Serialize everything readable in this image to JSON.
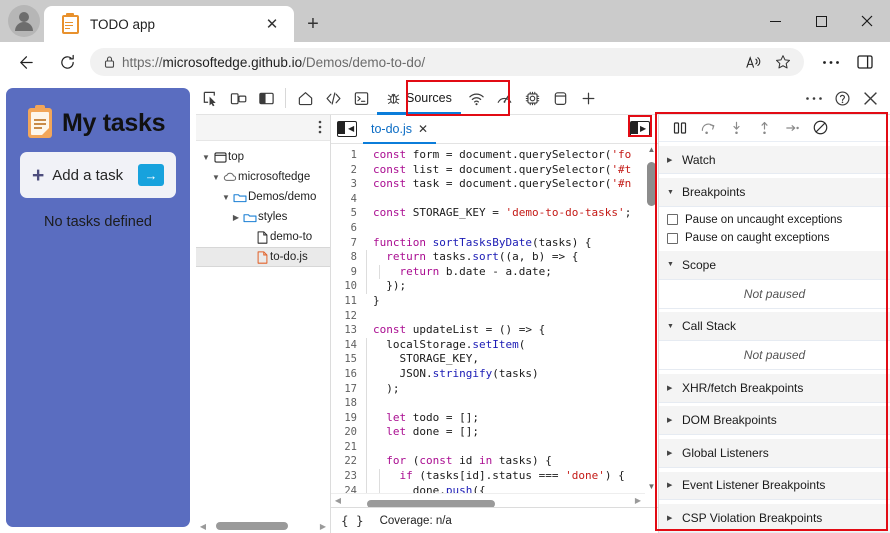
{
  "browser": {
    "tab": {
      "title": "TODO app",
      "favicon": "clipboard-icon",
      "close": "✕"
    },
    "newtab_label": "+",
    "window_controls": {
      "minimize": "—",
      "maximize": "☐",
      "close": "✕"
    },
    "address": {
      "url_prefix": "https://",
      "url_host": "microsoftedge.github.io",
      "url_path": "/Demos/demo-to-do/",
      "full_url": "https://microsoftedge.github.io/Demos/demo-to-do/",
      "lock_icon": "lock-icon",
      "back_icon": "back-arrow-icon",
      "reload_icon": "reload-icon",
      "read_aloud_icon": "read-aloud-icon",
      "favorite_icon": "star-icon",
      "settings_icon": "ellipsis-icon",
      "sidebar_icon": "split-screen-icon"
    }
  },
  "page": {
    "app_title": "My tasks",
    "add_task_label": "Add a task",
    "add_task_plus": "➕",
    "submit_arrow": "→",
    "empty_message": "No tasks defined"
  },
  "devtools": {
    "left_icons": [
      "inspect-icon",
      "device-emulation-icon",
      "dock-side-icon"
    ],
    "tabs": [
      {
        "name": "welcome",
        "icon": "home-icon",
        "label": ""
      },
      {
        "name": "elements",
        "icon": "code-icon",
        "label": ""
      },
      {
        "name": "console",
        "icon": "console-icon",
        "label": ""
      },
      {
        "name": "sources",
        "icon": "bug-icon",
        "label": "Sources",
        "active": true
      },
      {
        "name": "network",
        "icon": "wifi-icon",
        "label": ""
      },
      {
        "name": "performance",
        "icon": "gauge-icon",
        "label": ""
      },
      {
        "name": "memory",
        "icon": "chip-icon",
        "label": ""
      },
      {
        "name": "application",
        "icon": "database-icon",
        "label": ""
      },
      {
        "name": "more-tools",
        "icon": "plus-icon",
        "label": "+"
      }
    ],
    "right_icons": [
      "ellipsis-icon",
      "help-icon",
      "close-icon"
    ],
    "navigator": {
      "menu_icon": "kebab-menu-icon",
      "tree": [
        {
          "label": "top",
          "depth": 0,
          "expanded": true,
          "icon": "frame-icon"
        },
        {
          "label": "microsoftedge",
          "depth": 1,
          "expanded": true,
          "icon": "cloud-icon"
        },
        {
          "label": "Demos/demo",
          "depth": 2,
          "expanded": true,
          "icon": "folder-icon"
        },
        {
          "label": "styles",
          "depth": 3,
          "expanded": false,
          "icon": "folder-icon"
        },
        {
          "label": "demo-to",
          "depth": 3,
          "expanded": null,
          "icon": "file-icon"
        },
        {
          "label": "to-do.js",
          "depth": 3,
          "expanded": null,
          "icon": "js-file-icon",
          "selected": true
        }
      ]
    },
    "editor": {
      "back_button": "show-navigator-icon",
      "forward_button": "show-debugger-icon",
      "open_tab": {
        "label": "to-do.js",
        "close": "✕"
      },
      "lines": [
        {
          "n": 1,
          "tokens": [
            {
              "t": "const",
              "c": "kw"
            },
            {
              "t": " form = document.querySelector(",
              "c": "pl"
            },
            {
              "t": "'fo",
              "c": "str"
            }
          ]
        },
        {
          "n": 2,
          "tokens": [
            {
              "t": "const",
              "c": "kw"
            },
            {
              "t": " list = document.querySelector(",
              "c": "pl"
            },
            {
              "t": "'#t",
              "c": "str"
            }
          ]
        },
        {
          "n": 3,
          "tokens": [
            {
              "t": "const",
              "c": "kw"
            },
            {
              "t": " task = document.querySelector(",
              "c": "pl"
            },
            {
              "t": "'#n",
              "c": "str"
            }
          ]
        },
        {
          "n": 4,
          "tokens": []
        },
        {
          "n": 5,
          "tokens": [
            {
              "t": "const",
              "c": "kw"
            },
            {
              "t": " STORAGE_KEY = ",
              "c": "pl"
            },
            {
              "t": "'demo-to-do-tasks'",
              "c": "str"
            },
            {
              "t": ";",
              "c": "pl"
            }
          ]
        },
        {
          "n": 6,
          "tokens": []
        },
        {
          "n": 7,
          "tokens": [
            {
              "t": "function",
              "c": "kw"
            },
            {
              "t": " ",
              "c": "pl"
            },
            {
              "t": "sortTasksByDate",
              "c": "fn"
            },
            {
              "t": "(tasks) {",
              "c": "pl"
            }
          ]
        },
        {
          "n": 8,
          "tokens": [
            {
              "t": "  ",
              "c": "pl"
            },
            {
              "t": "return",
              "c": "kw"
            },
            {
              "t": " tasks.",
              "c": "pl"
            },
            {
              "t": "sort",
              "c": "fn"
            },
            {
              "t": "((a, b) => {",
              "c": "pl"
            }
          ]
        },
        {
          "n": 9,
          "tokens": [
            {
              "t": "    ",
              "c": "pl"
            },
            {
              "t": "return",
              "c": "kw"
            },
            {
              "t": " b.date - a.date;",
              "c": "pl"
            }
          ]
        },
        {
          "n": 10,
          "tokens": [
            {
              "t": "  });",
              "c": "pl"
            }
          ]
        },
        {
          "n": 11,
          "tokens": [
            {
              "t": "}",
              "c": "pl"
            }
          ]
        },
        {
          "n": 12,
          "tokens": []
        },
        {
          "n": 13,
          "tokens": [
            {
              "t": "const",
              "c": "kw"
            },
            {
              "t": " updateList = () => {",
              "c": "pl"
            }
          ]
        },
        {
          "n": 14,
          "tokens": [
            {
              "t": "  localStorage.",
              "c": "pl"
            },
            {
              "t": "setItem",
              "c": "fn"
            },
            {
              "t": "(",
              "c": "pl"
            }
          ]
        },
        {
          "n": 15,
          "tokens": [
            {
              "t": "    STORAGE_KEY,",
              "c": "pl"
            }
          ]
        },
        {
          "n": 16,
          "tokens": [
            {
              "t": "    JSON.",
              "c": "pl"
            },
            {
              "t": "stringify",
              "c": "fn"
            },
            {
              "t": "(tasks)",
              "c": "pl"
            }
          ]
        },
        {
          "n": 17,
          "tokens": [
            {
              "t": "  );",
              "c": "pl"
            }
          ]
        },
        {
          "n": 18,
          "tokens": []
        },
        {
          "n": 19,
          "tokens": [
            {
              "t": "  ",
              "c": "pl"
            },
            {
              "t": "let",
              "c": "kw"
            },
            {
              "t": " todo = [];",
              "c": "pl"
            }
          ]
        },
        {
          "n": 20,
          "tokens": [
            {
              "t": "  ",
              "c": "pl"
            },
            {
              "t": "let",
              "c": "kw"
            },
            {
              "t": " done = [];",
              "c": "pl"
            }
          ]
        },
        {
          "n": 21,
          "tokens": []
        },
        {
          "n": 22,
          "tokens": [
            {
              "t": "  ",
              "c": "pl"
            },
            {
              "t": "for",
              "c": "kw"
            },
            {
              "t": " (",
              "c": "pl"
            },
            {
              "t": "const",
              "c": "kw"
            },
            {
              "t": " id ",
              "c": "pl"
            },
            {
              "t": "in",
              "c": "kw"
            },
            {
              "t": " tasks) {",
              "c": "pl"
            }
          ]
        },
        {
          "n": 23,
          "tokens": [
            {
              "t": "    ",
              "c": "pl"
            },
            {
              "t": "if",
              "c": "kw"
            },
            {
              "t": " (tasks[id].status === ",
              "c": "pl"
            },
            {
              "t": "'done'",
              "c": "str"
            },
            {
              "t": ") {",
              "c": "pl"
            }
          ]
        },
        {
          "n": 24,
          "tokens": [
            {
              "t": "      done.",
              "c": "pl"
            },
            {
              "t": "push",
              "c": "fn"
            },
            {
              "t": "({",
              "c": "pl"
            }
          ]
        }
      ]
    },
    "statusbar": {
      "braces": "{ }",
      "coverage": "Coverage: n/a"
    },
    "debugger": {
      "toolbar": [
        {
          "name": "pause-resume-button",
          "icon": "pause-icon"
        },
        {
          "name": "step-over-button",
          "icon": "step-over-icon"
        },
        {
          "name": "step-into-button",
          "icon": "step-into-icon"
        },
        {
          "name": "step-out-button",
          "icon": "step-out-icon"
        },
        {
          "name": "step-button",
          "icon": "step-icon"
        },
        {
          "name": "deactivate-breakpoints-button",
          "icon": "no-breakpoints-icon"
        }
      ],
      "sections": [
        {
          "label": "Watch",
          "expanded": false
        },
        {
          "label": "Breakpoints",
          "expanded": true
        },
        {
          "label": "Scope",
          "expanded": true
        },
        {
          "label": "Call Stack",
          "expanded": true
        },
        {
          "label": "XHR/fetch Breakpoints",
          "expanded": false
        },
        {
          "label": "DOM Breakpoints",
          "expanded": false
        },
        {
          "label": "Global Listeners",
          "expanded": false
        },
        {
          "label": "Event Listener Breakpoints",
          "expanded": false
        },
        {
          "label": "CSP Violation Breakpoints",
          "expanded": false
        }
      ],
      "checkboxes": [
        {
          "label": "Pause on uncaught exceptions",
          "checked": false
        },
        {
          "label": "Pause on caught exceptions",
          "checked": false
        }
      ],
      "scope_status": "Not paused",
      "callstack_status": "Not paused"
    }
  },
  "annotations": {
    "highlight_color": "#e20b14",
    "boxes": [
      "sources-tab-highlight",
      "show-debugger-button-highlight",
      "debugger-pane-highlight"
    ]
  }
}
